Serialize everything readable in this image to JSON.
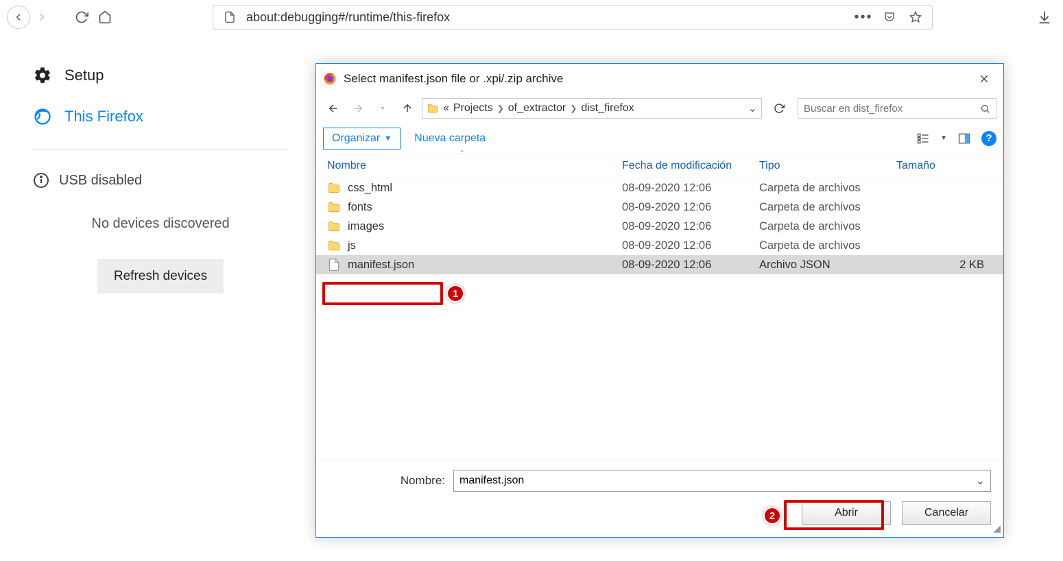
{
  "toolbar": {
    "url": "about:debugging#/runtime/this-firefox"
  },
  "sidebar": {
    "setup_label": "Setup",
    "thisfirefox_label": "This Firefox",
    "usb_label": "USB disabled",
    "no_devices": "No devices discovered",
    "refresh_label": "Refresh devices"
  },
  "dialog": {
    "title": "Select manifest.json file or .xpi/.zip archive",
    "breadcrumbs": {
      "root": "Projects",
      "mid": "of_extractor",
      "leaf": "dist_firefox",
      "prefix": "«"
    },
    "search_placeholder": "Buscar en dist_firefox",
    "organize_label": "Organizar",
    "newfolder_label": "Nueva carpeta",
    "columns": {
      "name": "Nombre",
      "date": "Fecha de modificación",
      "type": "Tipo",
      "size": "Tamaño"
    },
    "rows": [
      {
        "name": "css_html",
        "date": "08-09-2020 12:06",
        "type": "Carpeta de archivos",
        "size": "",
        "kind": "folder",
        "selected": false
      },
      {
        "name": "fonts",
        "date": "08-09-2020 12:06",
        "type": "Carpeta de archivos",
        "size": "",
        "kind": "folder",
        "selected": false
      },
      {
        "name": "images",
        "date": "08-09-2020 12:06",
        "type": "Carpeta de archivos",
        "size": "",
        "kind": "folder",
        "selected": false
      },
      {
        "name": "js",
        "date": "08-09-2020 12:06",
        "type": "Carpeta de archivos",
        "size": "",
        "kind": "folder",
        "selected": false
      },
      {
        "name": "manifest.json",
        "date": "08-09-2020 12:06",
        "type": "Archivo JSON",
        "size": "2 KB",
        "kind": "file",
        "selected": true
      }
    ],
    "name_label": "Nombre:",
    "name_value": "manifest.json",
    "open_label": "Abrir",
    "cancel_label": "Cancelar"
  },
  "annotations": {
    "one": "1",
    "two": "2"
  }
}
